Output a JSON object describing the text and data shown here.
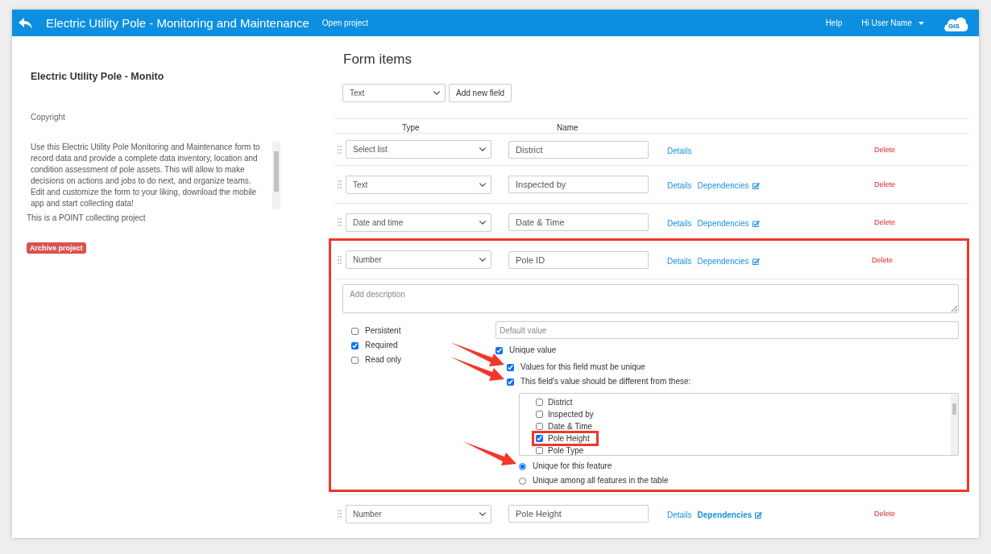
{
  "header": {
    "title": "Electric Utility Pole - Monitoring and Maintenance",
    "link": "Open project",
    "help": "Help",
    "user": "Hi User Name",
    "logo": "GIS"
  },
  "project": {
    "name": "Electric Utility Pole - Monito",
    "copyright": "Copyright",
    "description": "Use this Electric Utility Pole Monitoring and Maintenance form to record data and provide a complete data inventory, location and condition assessment of pole assets. This will allow to make decisions on actions and jobs to do next, and organize teams.\nEdit and customize the form to your liking, download the mobile app and start collecting data!",
    "collecting": "This is a POINT collecting project",
    "archive_button": "Archive project"
  },
  "form": {
    "title": "Form items",
    "new_field_type": "Text",
    "add_button": "Add new field",
    "columns": [
      "Type",
      "Name"
    ],
    "fields": [
      {
        "type": "Select list",
        "name": "District",
        "details": "Details",
        "delete": "Delete",
        "highlighted": false
      },
      {
        "type": "Text",
        "name": "Inspected by",
        "details": "Details",
        "dependencies": "Dependencies",
        "dependencies_set": false,
        "delete": "Delete",
        "highlighted": false
      },
      {
        "type": "Date and time",
        "name": "Date & Time",
        "details": "Details",
        "dependencies": "Dependencies",
        "dependencies_set": false,
        "delete": "Delete",
        "highlighted": false
      },
      {
        "type": "Number",
        "name": "Pole ID",
        "details": "Details",
        "dependencies": "Dependencies",
        "dependencies_set": false,
        "delete": "Delete",
        "highlighted": true,
        "settings": {
          "description_placeholder": "Add description",
          "default_placeholder": "Default value",
          "flags": [
            {
              "label": "Persistent",
              "checked": false
            },
            {
              "label": "Required",
              "checked": true
            },
            {
              "label": "Read only",
              "checked": false
            }
          ],
          "unique": {
            "label": "Unique value",
            "checked": true
          },
          "unique_options": [
            {
              "label": "Values for this field must be unique",
              "checked": true,
              "pointed": true
            },
            {
              "label": "This field's value should be different from these:",
              "checked": true,
              "pointed": true
            }
          ],
          "compare_fields": [
            {
              "label": "District",
              "checked": false,
              "highlighted": false
            },
            {
              "label": "Inspected by",
              "checked": false,
              "highlighted": false
            },
            {
              "label": "Date & Time",
              "checked": false,
              "highlighted": false
            },
            {
              "label": "Pole Height",
              "checked": true,
              "highlighted": true
            },
            {
              "label": "Pole Type",
              "checked": false,
              "highlighted": false
            }
          ],
          "scopes": [
            {
              "label": "Unique for this feature",
              "selected": true,
              "pointed": true
            },
            {
              "label": "Unique among all features in the table",
              "selected": false,
              "pointed": false
            }
          ]
        }
      },
      {
        "type": "Number",
        "name": "Pole Height",
        "details": "Details",
        "dependencies": "Dependencies",
        "dependencies_set": true,
        "delete": "Delete",
        "highlighted": false
      }
    ]
  }
}
